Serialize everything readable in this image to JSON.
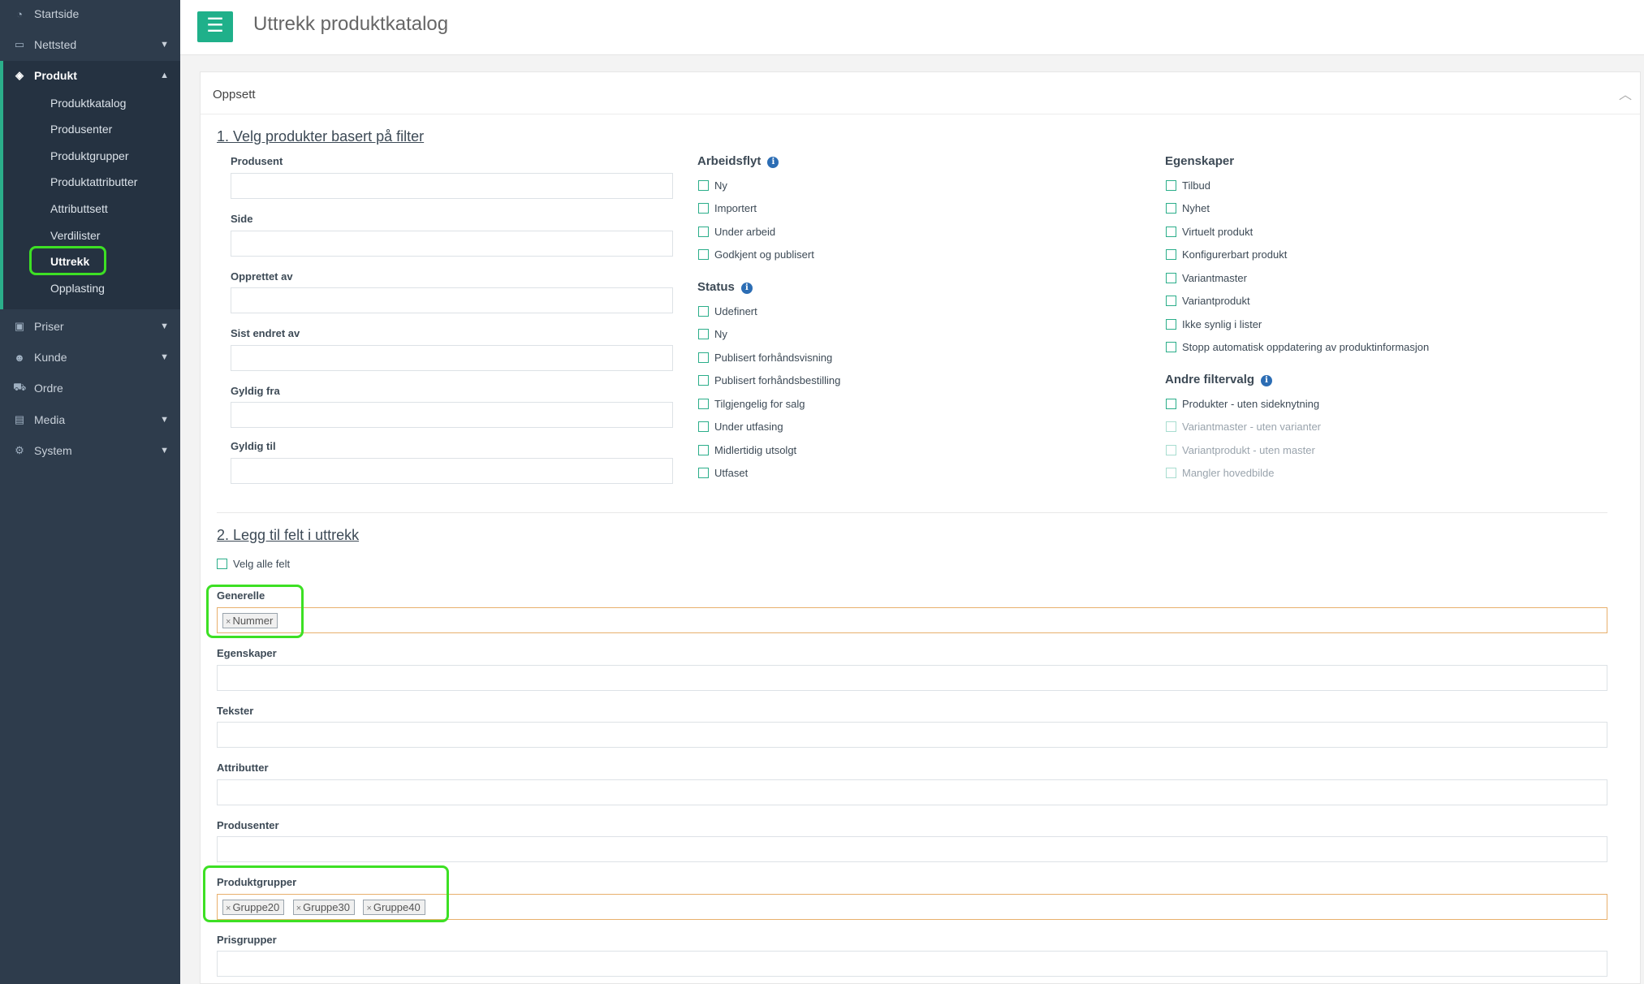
{
  "sidebar": {
    "startside": "Startside",
    "nettsted": "Nettsted",
    "produkt": "Produkt",
    "sub_items": [
      "Produktkatalog",
      "Produsenter",
      "Produktgrupper",
      "Produktattributter",
      "Attributtsett",
      "Verdilister",
      "Uttrekk",
      "Opplasting"
    ],
    "priser": "Priser",
    "kunde": "Kunde",
    "ordre": "Ordre",
    "media": "Media",
    "system": "System"
  },
  "header": {
    "title": "Uttrekk produktkatalog",
    "menu_icon": "hamburger-icon"
  },
  "panel": {
    "title": "Oppsett"
  },
  "section1": {
    "title": "1. Velg produkter basert på filter",
    "fields": [
      "Produsent",
      "Side",
      "Opprettet av",
      "Sist endret av",
      "Gyldig fra",
      "Gyldig til"
    ],
    "arbeidsflyt": {
      "title": "Arbeidsflyt",
      "options": [
        "Ny",
        "Importert",
        "Under arbeid",
        "Godkjent og publisert"
      ]
    },
    "status": {
      "title": "Status",
      "options": [
        "Udefinert",
        "Ny",
        "Publisert forhåndsvisning",
        "Publisert forhåndsbestilling",
        "Tilgjengelig for salg",
        "Under utfasing",
        "Midlertidig utsolgt",
        "Utfaset"
      ]
    },
    "egenskaper": {
      "title": "Egenskaper",
      "options": [
        "Tilbud",
        "Nyhet",
        "Virtuelt produkt",
        "Konfigurerbart produkt",
        "Variantmaster",
        "Variantprodukt",
        "Ikke synlig i lister",
        "Stopp automatisk oppdatering av produktinformasjon"
      ]
    },
    "andre": {
      "title": "Andre filtervalg",
      "options": [
        "Produkter - uten sideknytning",
        "Variantmaster - uten varianter",
        "Variantprodukt - uten master",
        "Mangler hovedbilde"
      ]
    }
  },
  "section2": {
    "title": "2. Legg til felt i uttrekk",
    "select_all": "Velg alle felt",
    "groups": [
      "Generelle",
      "Egenskaper",
      "Tekster",
      "Attributter",
      "Produsenter",
      "Produktgrupper",
      "Prisgrupper"
    ],
    "generelle_tags": [
      "Nummer"
    ],
    "produktgrupper_tags": [
      "Gruppe20",
      "Gruppe30",
      "Gruppe40"
    ]
  },
  "colors": {
    "sidebar": "#2e3c4c",
    "accent": "#1fb08a",
    "highlight": "#3de024",
    "focus_border": "#e8b06d"
  }
}
